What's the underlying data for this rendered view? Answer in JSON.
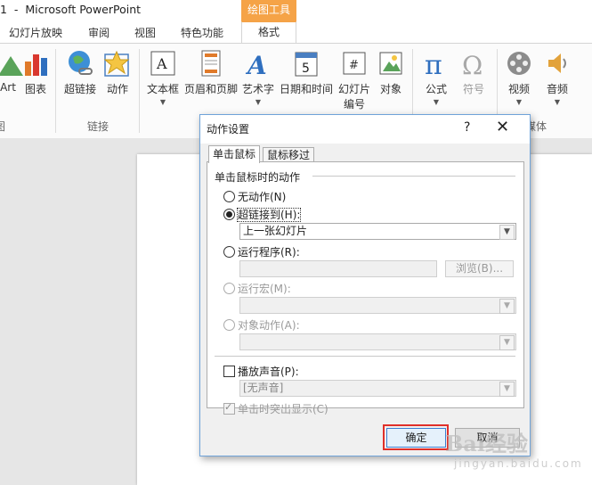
{
  "window": {
    "title": "1  -  Microsoft PowerPoint",
    "context_tab_title": "绘图工具"
  },
  "tabs": [
    "幻灯片放映",
    "审阅",
    "视图",
    "特色功能",
    "格式"
  ],
  "ribbon": {
    "buttons": [
      {
        "label": "Art",
        "icon": "smartart-icon"
      },
      {
        "label": "图表",
        "icon": "chart-icon"
      },
      {
        "label": "超链接",
        "icon": "hyperlink-globe-icon"
      },
      {
        "label": "动作",
        "icon": "action-star-icon"
      },
      {
        "label": "文本框",
        "icon": "textbox-icon"
      },
      {
        "label": "页眉和页脚",
        "icon": "header-footer-icon"
      },
      {
        "label": "艺术字",
        "icon": "wordart-icon"
      },
      {
        "label": "日期和时间",
        "icon": "calendar-icon"
      },
      {
        "label": "幻灯片",
        "label2": "编号",
        "icon": "slide-number-icon"
      },
      {
        "label": "对象",
        "icon": "object-icon"
      },
      {
        "label": "公式",
        "icon": "pi-icon"
      },
      {
        "label": "符号",
        "icon": "omega-icon"
      },
      {
        "label": "视频",
        "icon": "film-reel-icon"
      },
      {
        "label": "音频",
        "icon": "speaker-icon"
      }
    ],
    "groups": [
      "图",
      "链接",
      "媒体"
    ]
  },
  "dialog": {
    "title": "动作设置",
    "help": "?",
    "close": "✕",
    "tabs": [
      "单击鼠标",
      "鼠标移过"
    ],
    "section_label": "单击鼠标时的动作",
    "options": {
      "none": "无动作(N)",
      "hyperlink": "超链接到(H):",
      "hyperlink_value": "上一张幻灯片",
      "run_program": "运行程序(R):",
      "browse": "浏览(B)...",
      "run_macro": "运行宏(M):",
      "object_action": "对象动作(A):"
    },
    "play_sound": "播放声音(P):",
    "sound_value": "[无声音]",
    "highlight_click": "单击时突出显示(C)",
    "ok": "确定",
    "cancel": "取消"
  },
  "watermark": {
    "text1": "Bai",
    "text2": "经验",
    "text3": "jingyan.baidu.com"
  },
  "colors": {
    "accent": "#f5a347",
    "highlight_box": "#e0302a",
    "dialog_border": "#6fa3d9"
  }
}
